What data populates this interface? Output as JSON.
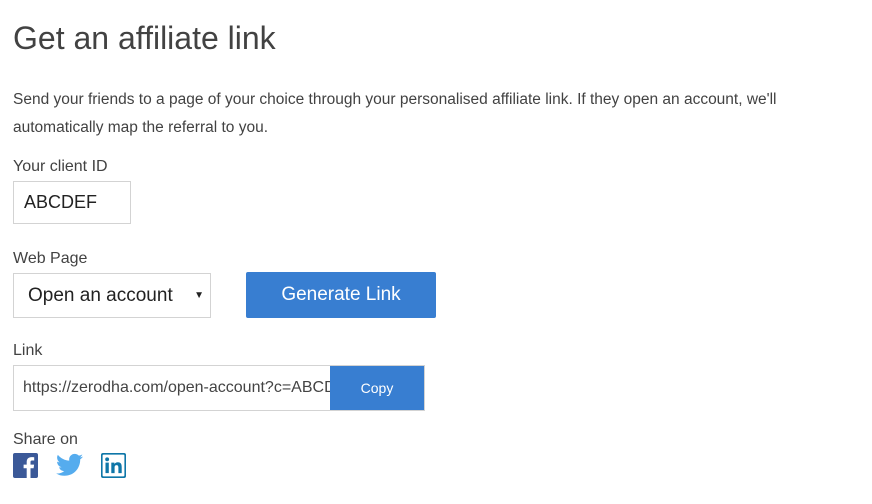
{
  "page": {
    "title": "Get an affiliate link",
    "description": "Send your friends to a page of your choice through your personalised affiliate link. If they open an account, we'll automatically map the referral to you."
  },
  "client_id": {
    "label": "Your client ID",
    "value": "ABCDEF"
  },
  "web_page": {
    "label": "Web Page",
    "selected": "Open an account"
  },
  "generate_button": {
    "label": "Generate Link"
  },
  "link": {
    "label": "Link",
    "value": "https://zerodha.com/open-account?c=ABCDEF",
    "copy_label": "Copy"
  },
  "share": {
    "label": "Share on",
    "icons": [
      "facebook-icon",
      "twitter-icon",
      "linkedin-icon"
    ]
  },
  "colors": {
    "accent": "#387ed1",
    "facebook": "#3b5998",
    "twitter": "#55acee",
    "linkedin": "#0e76a8"
  }
}
